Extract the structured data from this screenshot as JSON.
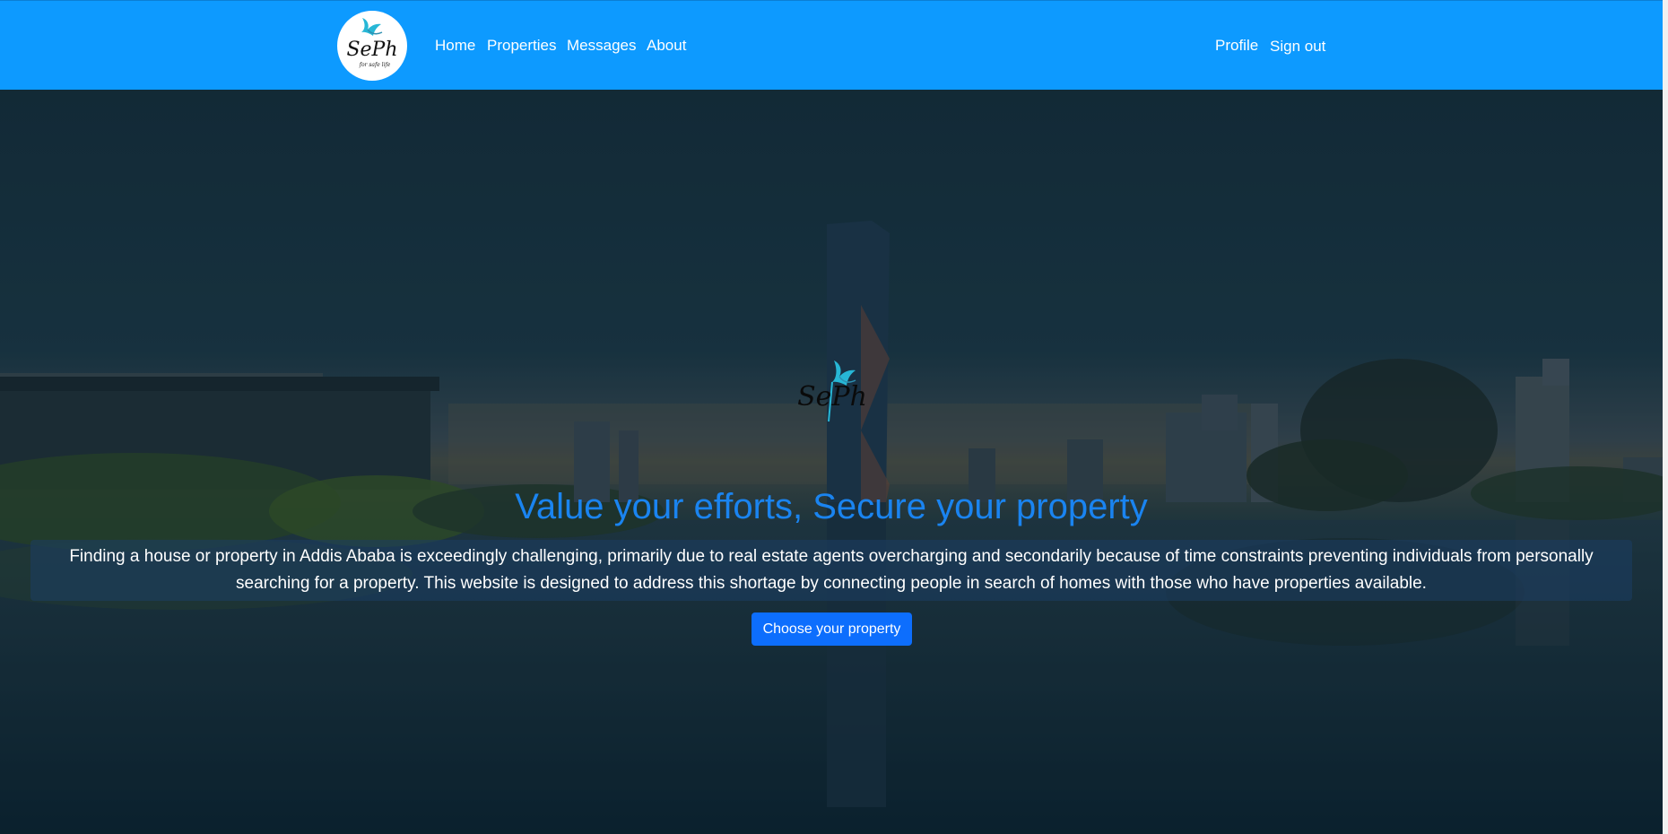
{
  "brand": {
    "logo_text": "SePh",
    "tagline": "for safe life",
    "logo_icon": "bird-icon"
  },
  "nav": {
    "left": [
      "Home",
      "Properties",
      "Messages",
      "About"
    ],
    "right": [
      "Profile",
      "Sign out"
    ]
  },
  "hero": {
    "logo_text": "SePh",
    "title": "Value your efforts, Secure your property",
    "description": "Finding a house or property in Addis Ababa is exceedingly challenging, primarily due to real estate agents overcharging and secondarily because of time constraints preventing individuals from personally searching for a property. This website is designed to address this shortage by connecting people in search of homes with those who have properties available.",
    "cta_label": "Choose your property"
  },
  "colors": {
    "navbar": "#0d9aff",
    "title": "#1a84f0",
    "button": "#0d6efd"
  }
}
